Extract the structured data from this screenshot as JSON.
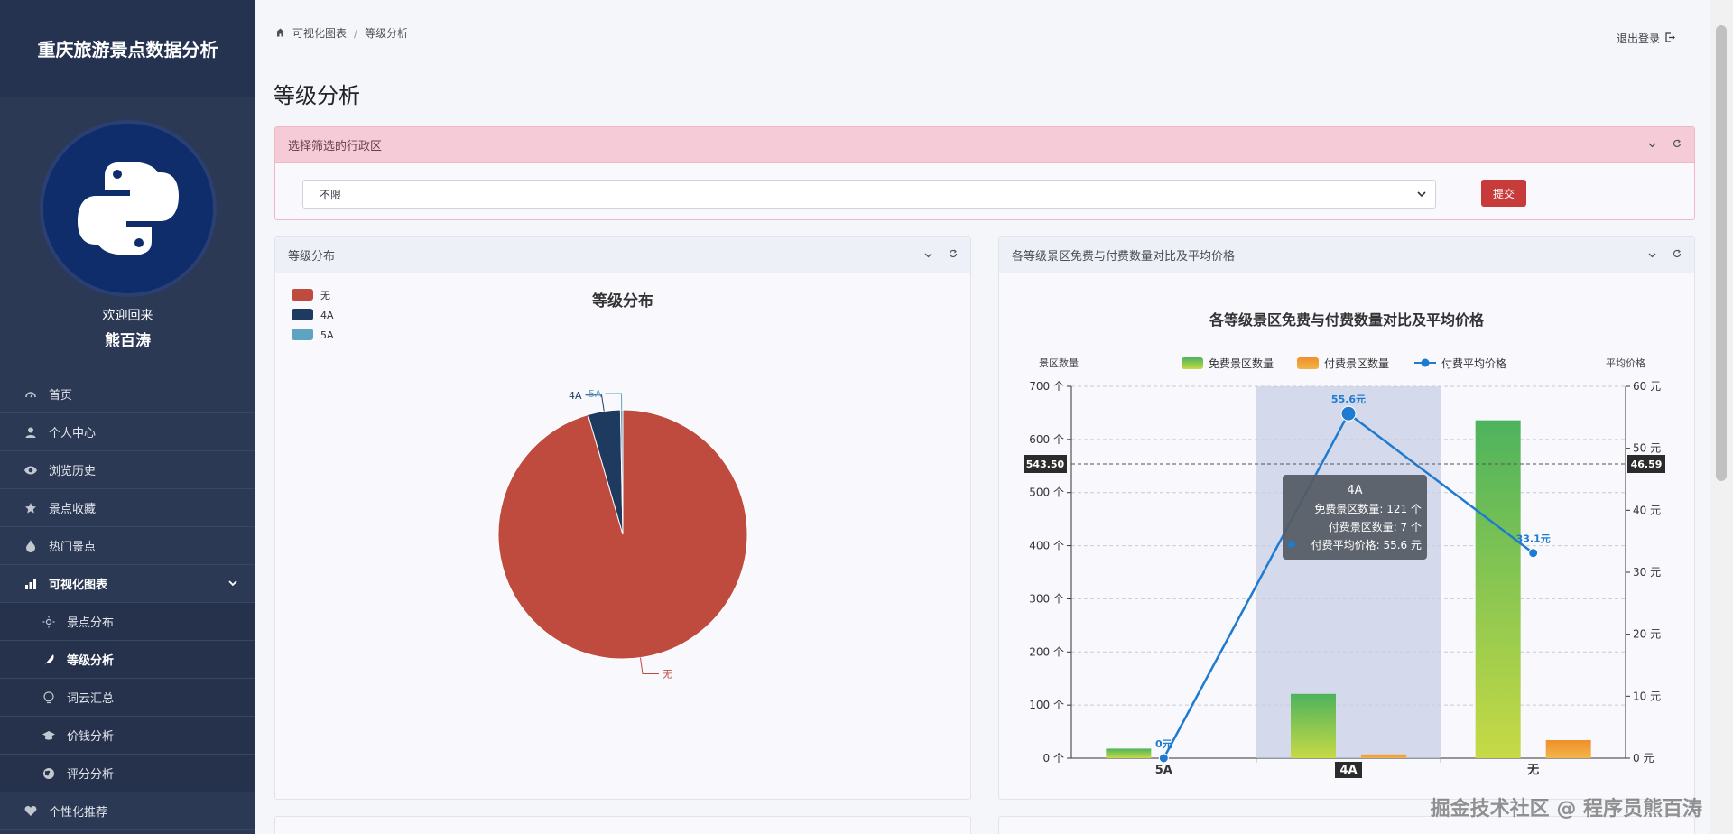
{
  "sidebar": {
    "brand": "重庆旅游景点数据分析",
    "welcome": "欢迎回来",
    "username": "熊百涛",
    "items": [
      {
        "label": "首页",
        "icon": "dashboard-icon"
      },
      {
        "label": "个人中心",
        "icon": "user-icon"
      },
      {
        "label": "浏览历史",
        "icon": "eye-icon"
      },
      {
        "label": "景点收藏",
        "icon": "star-icon"
      },
      {
        "label": "热门景点",
        "icon": "fire-icon"
      },
      {
        "label": "可视化图表",
        "icon": "bar-chart-icon"
      }
    ],
    "subitems": [
      {
        "label": "景点分布",
        "icon": "sun-icon"
      },
      {
        "label": "等级分析",
        "icon": "feather-icon"
      },
      {
        "label": "词云汇总",
        "icon": "lightbulb-icon"
      },
      {
        "label": "价钱分析",
        "icon": "graduation-cap-icon"
      },
      {
        "label": "评分分析",
        "icon": "globe-icon"
      }
    ],
    "last_item": {
      "label": "个性化推荐",
      "icon": "heart-icon"
    }
  },
  "breadcrumb": {
    "home": "可视化图表",
    "sep": "/",
    "current": "等级分析"
  },
  "logout": "退出登录",
  "page_title": "等级分析",
  "filter": {
    "header": "选择筛选的行政区",
    "value": "不限",
    "submit": "提交"
  },
  "pie_card": {
    "header": "等级分布"
  },
  "bar_card": {
    "header": "各等级景区免费与付费数量对比及平均价格"
  },
  "tooltip": {
    "title": "4A",
    "line1": "免费景区数量: 121 个",
    "line2": "付费景区数量: 7 个",
    "line3": "付费平均价格: 55.6 元"
  },
  "axis_pointer": {
    "left": "543.50",
    "right": "46.59"
  },
  "watermark": "掘金技术社区 @ 程序员熊百涛",
  "colors": {
    "none": "#bf4b3e",
    "a4": "#1e3a5f",
    "a5": "#5ea4c0",
    "free_top": "#5cb85c",
    "paid": "#f0a030",
    "line": "#1e7bd0"
  },
  "chart_data": [
    {
      "type": "pie",
      "title": "等级分布",
      "series": [
        {
          "name": "无",
          "value": 636
        },
        {
          "name": "4A",
          "value": 28
        },
        {
          "name": "5A",
          "value": 2
        }
      ],
      "legend": [
        "无",
        "4A",
        "5A"
      ],
      "legend_position": "top-left"
    },
    {
      "type": "bar",
      "title": "各等级景区免费与付费数量对比及平均价格",
      "categories": [
        "5A",
        "4A",
        "无"
      ],
      "series": [
        {
          "name": "免费景区数量",
          "values": [
            18,
            121,
            636
          ]
        },
        {
          "name": "付费景区数量",
          "values": [
            0,
            7,
            34
          ]
        },
        {
          "name": "付费平均价格",
          "values": [
            0,
            55.6,
            33.1
          ],
          "labels": [
            "0元",
            "55.6元",
            "33.1元"
          ]
        }
      ],
      "ylabel": "景区数量",
      "y2label": "平均价格",
      "ylim": [
        0,
        700
      ],
      "y2lim": [
        0,
        60
      ],
      "yticks": [
        "0 个",
        "100 个",
        "200 个",
        "300 个",
        "400 个",
        "500 个",
        "600 个",
        "700 个"
      ],
      "y2ticks": [
        "0 元",
        "10 元",
        "20 元",
        "30 元",
        "40 元",
        "50 元",
        "60 元"
      ],
      "grid": true,
      "legend_position": "top"
    }
  ]
}
